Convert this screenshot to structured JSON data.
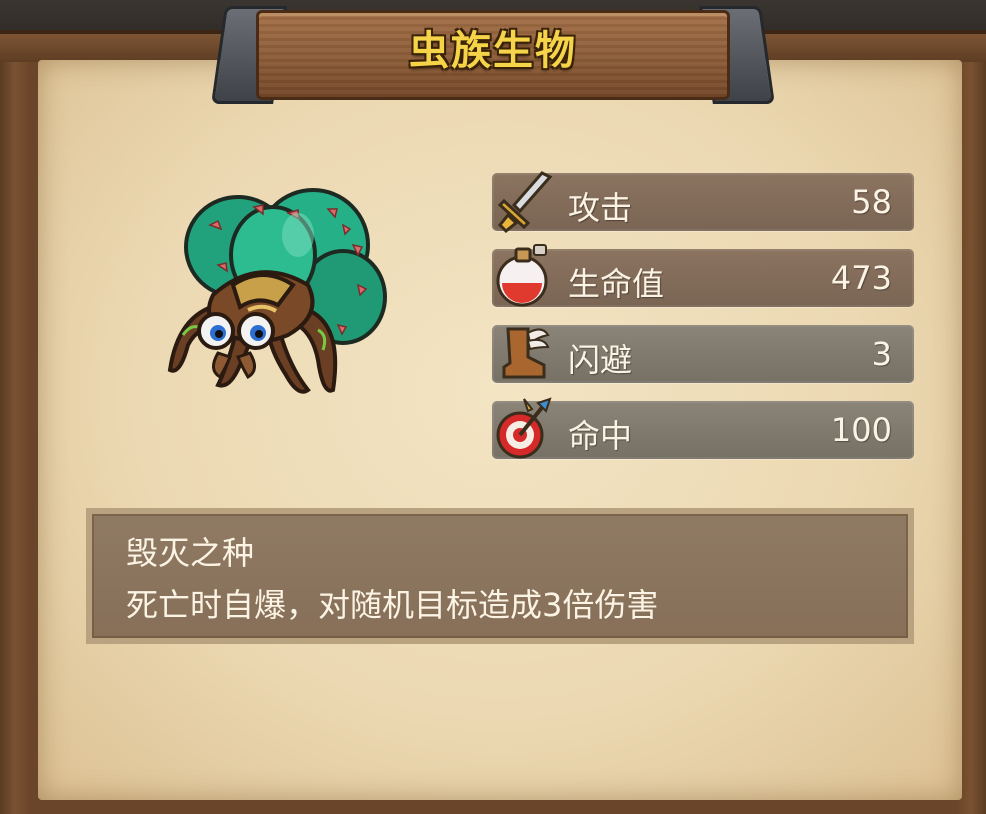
{
  "title": "虫族生物",
  "creature": {
    "icon": "green-egg-spider-creature"
  },
  "stats": [
    {
      "icon": "sword-icon",
      "label": "攻击",
      "value": "58"
    },
    {
      "icon": "red-potion-icon",
      "label": "生命值",
      "value": "473"
    },
    {
      "icon": "winged-boot-icon",
      "label": "闪避",
      "value": "3"
    },
    {
      "icon": "target-arrow-icon",
      "label": "命中",
      "value": "100"
    }
  ],
  "skill": {
    "name": "毁灭之种",
    "description": "死亡时自爆，对随机目标造成3倍伤害"
  },
  "colors": {
    "title": "#f5d44a",
    "stat_text": "#fbf3e3",
    "parchment": "#ecd9b3"
  }
}
